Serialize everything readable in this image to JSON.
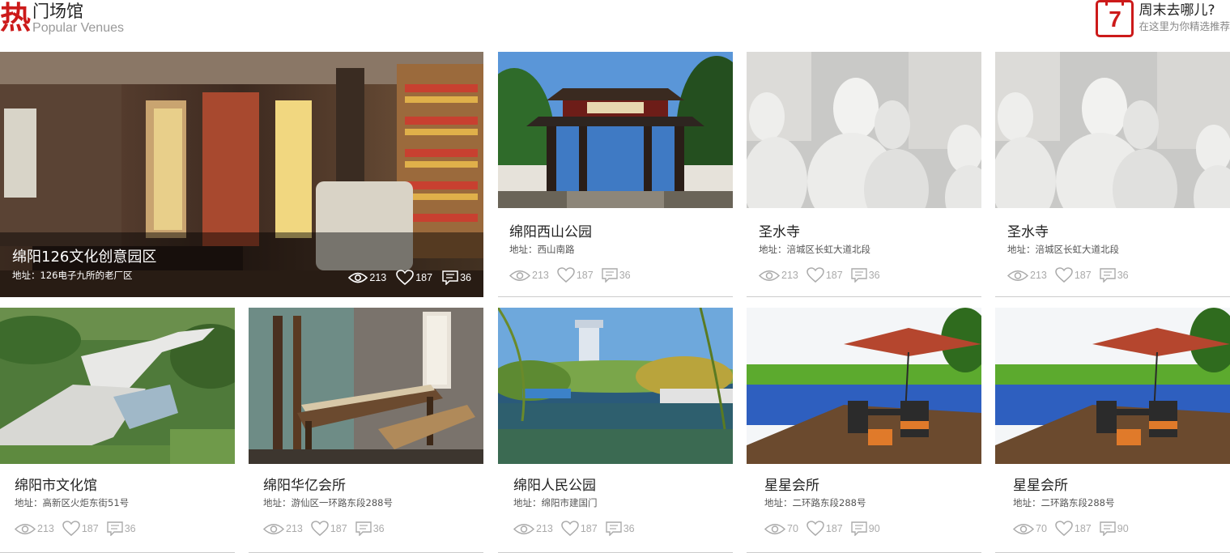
{
  "header": {
    "hot_char": "热",
    "title": "门场馆",
    "subtitle": "Popular Venues",
    "weekend_title": "周末去哪儿?",
    "weekend_subtitle": "在这里为你精选推荐",
    "calendar_number": "7"
  },
  "colors": {
    "accent": "#cc1a1a"
  },
  "featured": {
    "name": "绵阳126文化创意园区",
    "address": "地址：126电子九所的老厂区",
    "views": "213",
    "likes": "187",
    "comments": "36"
  },
  "venues": [
    {
      "name": "绵阳西山公园",
      "address": "地址：西山南路",
      "views": "213",
      "likes": "187",
      "comments": "36"
    },
    {
      "name": "圣水寺",
      "address": "地址：涪城区长虹大道北段",
      "views": "213",
      "likes": "187",
      "comments": "36"
    },
    {
      "name": "圣水寺",
      "address": "地址：涪城区长虹大道北段",
      "views": "213",
      "likes": "187",
      "comments": "36"
    },
    {
      "name": "绵阳市文化馆",
      "address": "地址：高新区火炬东街51号",
      "views": "213",
      "likes": "187",
      "comments": "36"
    },
    {
      "name": "绵阳华亿会所",
      "address": "地址：游仙区一环路东段288号",
      "views": "213",
      "likes": "187",
      "comments": "36"
    },
    {
      "name": "绵阳人民公园",
      "address": "地址：绵阳市建国门",
      "views": "213",
      "likes": "187",
      "comments": "36"
    },
    {
      "name": "星星会所",
      "address": "地址：二环路东段288号",
      "views": "70",
      "likes": "187",
      "comments": "90"
    },
    {
      "name": "星星会所",
      "address": "地址：二环路东段288号",
      "views": "70",
      "likes": "187",
      "comments": "90"
    }
  ],
  "icons": {
    "views": "eye-icon",
    "likes": "heart-icon",
    "comments": "comment-icon",
    "calendar": "calendar-icon"
  }
}
